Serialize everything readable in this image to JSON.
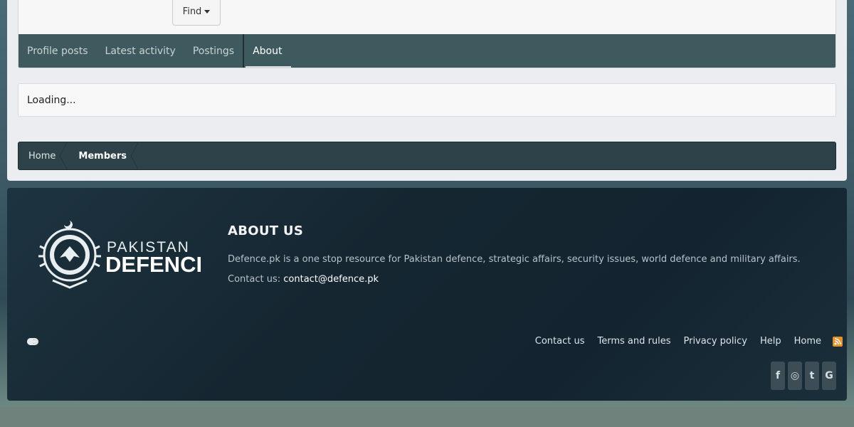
{
  "header": {
    "find_label": "Find"
  },
  "tabs": [
    {
      "label": "Profile posts"
    },
    {
      "label": "Latest activity"
    },
    {
      "label": "Postings"
    },
    {
      "label": "About"
    }
  ],
  "content": {
    "loading_text": "Loading..."
  },
  "breadcrumb": [
    {
      "label": "Home"
    },
    {
      "label": "Members"
    }
  ],
  "footer": {
    "logo_text_top": "PAKISTAN",
    "logo_text_main": "DEFENCE",
    "about_title": "ABOUT US",
    "about_desc": "Defence.pk is a one stop resource for Pakistan defence, strategic affairs, security issues, world defence and military affairs.",
    "contact_prefix": "Contact us:",
    "contact_email": "contact@defence.pk",
    "links": [
      {
        "label": "Contact us"
      },
      {
        "label": "Terms and rules"
      },
      {
        "label": "Privacy policy"
      },
      {
        "label": "Help"
      },
      {
        "label": "Home"
      }
    ],
    "social": [
      {
        "icon": "facebook-icon",
        "glyph": "f"
      },
      {
        "icon": "instagram-icon",
        "glyph": "◎"
      },
      {
        "icon": "twitter-icon",
        "glyph": "t"
      },
      {
        "icon": "google-icon",
        "glyph": "G"
      }
    ]
  },
  "colors": {
    "tab_bar": "#3e5a5e",
    "breadcrumb_bg": "#2d4349",
    "footer_bg": "#152631",
    "rss": "#e8912a"
  }
}
